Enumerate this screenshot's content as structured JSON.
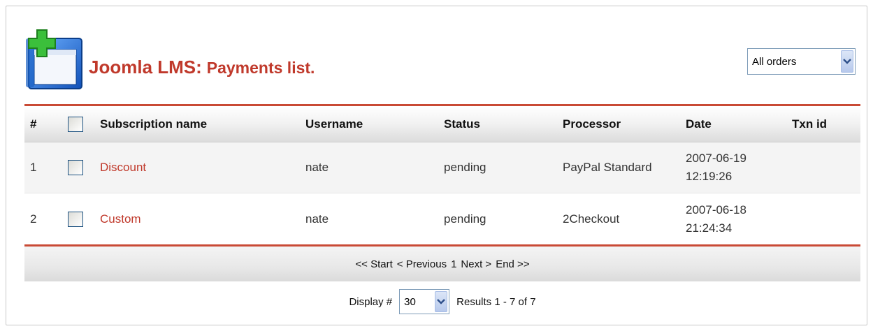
{
  "header": {
    "title_app": "Joomla LMS:",
    "title_page": "Payments list.",
    "filter": {
      "selected": "All orders"
    }
  },
  "table": {
    "columns": [
      "#",
      "Subscription name",
      "Username",
      "Status",
      "Processor",
      "Date",
      "Txn id"
    ],
    "rows": [
      {
        "num": "1",
        "subscription": "Discount",
        "username": "nate",
        "status": "pending",
        "processor": "PayPal Standard",
        "date": "2007-06-19",
        "time": "12:19:26",
        "txn": ""
      },
      {
        "num": "2",
        "subscription": "Custom",
        "username": "nate",
        "status": "pending",
        "processor": "2Checkout",
        "date": "2007-06-18",
        "time": "21:24:34",
        "txn": ""
      }
    ]
  },
  "pagination": {
    "start": "<< Start",
    "previous": "< Previous",
    "page": "1",
    "next": "Next >",
    "end": "End >>"
  },
  "footer": {
    "display_label": "Display #",
    "display_value": "30",
    "results": "Results 1 - 7 of 7"
  },
  "colors": {
    "accent": "#c0392b",
    "rule": "#c94a35"
  }
}
